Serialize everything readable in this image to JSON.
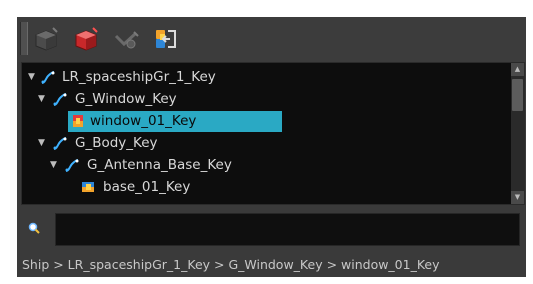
{
  "toolbar": {
    "buttons": [
      {
        "name": "create-drawing-button",
        "icon": "dark-cube-icon"
      },
      {
        "name": "create-key-button",
        "icon": "red-cube-icon"
      },
      {
        "name": "peg-button",
        "icon": "peg-icon"
      },
      {
        "name": "export-button",
        "icon": "export-icon"
      }
    ]
  },
  "tree": {
    "rows": [
      {
        "label": "LR_spaceshipGr_1_Key",
        "icon": "group-node-icon",
        "expanded": true,
        "selected": false
      },
      {
        "label": "G_Window_Key",
        "icon": "group-node-icon",
        "expanded": true,
        "selected": false
      },
      {
        "label": "window_01_Key",
        "icon": "drawing-node-icon",
        "expanded": false,
        "selected": true
      },
      {
        "label": "G_Body_Key",
        "icon": "group-node-icon",
        "expanded": true,
        "selected": false
      },
      {
        "label": "G_Antenna_Base_Key",
        "icon": "group-node-icon",
        "expanded": true,
        "selected": false
      },
      {
        "label": "base_01_Key",
        "icon": "drawing-node-icon",
        "expanded": false,
        "selected": false
      }
    ]
  },
  "search": {
    "value": "",
    "placeholder": ""
  },
  "path": "Ship > LR_spaceshipGr_1_Key > G_Window_Key > window_01_Key",
  "colors": {
    "selection": "#2aa9c4",
    "panel": "#3a3a3a",
    "tree_bg": "#0d0d0d"
  }
}
